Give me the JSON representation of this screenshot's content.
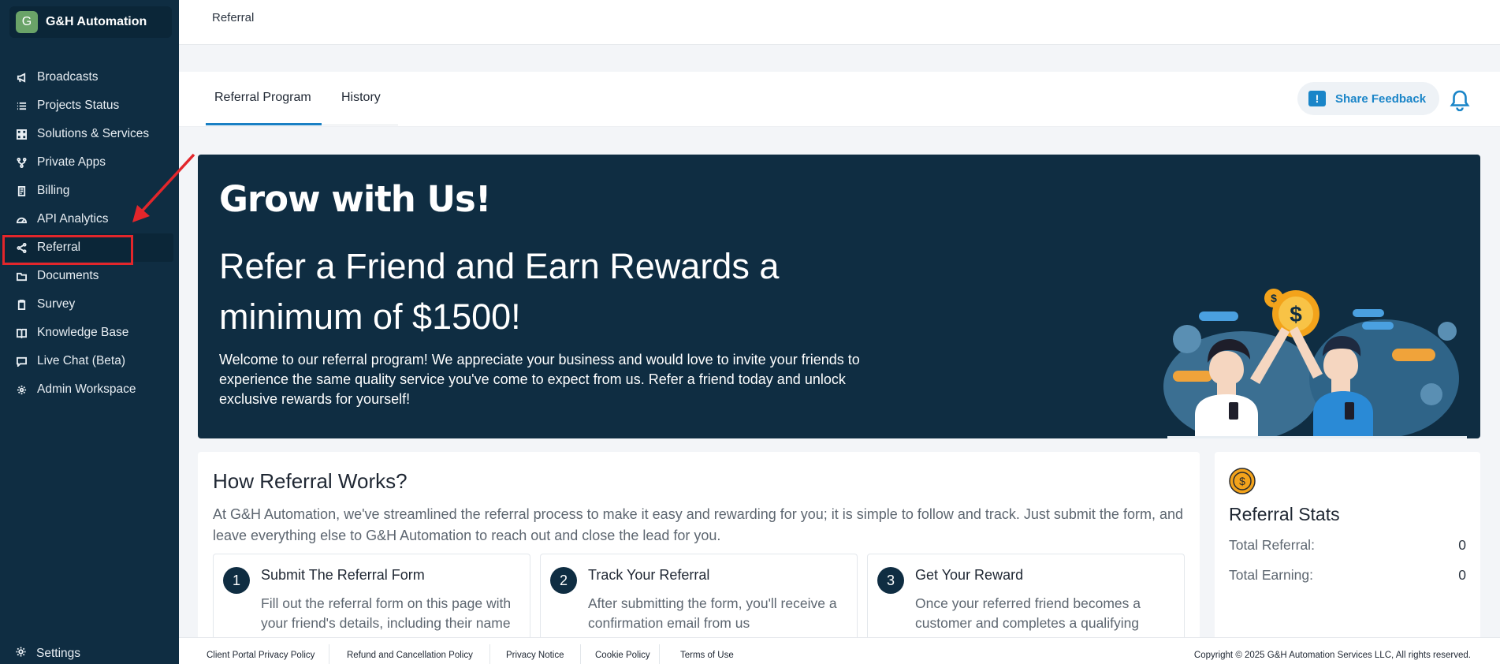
{
  "brand": {
    "initial": "G",
    "name": "G&H Automation"
  },
  "nav": {
    "items": [
      {
        "label": "Broadcasts",
        "icon": "megaphone-icon"
      },
      {
        "label": "Projects Status",
        "icon": "list-icon"
      },
      {
        "label": "Solutions & Services",
        "icon": "grid-icon"
      },
      {
        "label": "Private Apps",
        "icon": "fork-icon"
      },
      {
        "label": "Billing",
        "icon": "receipt-icon"
      },
      {
        "label": "API Analytics",
        "icon": "gauge-icon"
      },
      {
        "label": "Referral",
        "icon": "share-icon"
      },
      {
        "label": "Documents",
        "icon": "folder-icon"
      },
      {
        "label": "Survey",
        "icon": "clipboard-icon"
      },
      {
        "label": "Knowledge Base",
        "icon": "book-icon"
      },
      {
        "label": "Live Chat (Beta)",
        "icon": "chat-icon"
      },
      {
        "label": "Admin Workspace",
        "icon": "admin-icon"
      }
    ],
    "active": "Referral",
    "settings_label": "Settings"
  },
  "header": {
    "breadcrumb": "Referral"
  },
  "tabs": [
    {
      "label": "Referral Program",
      "active": true
    },
    {
      "label": "History",
      "active": false
    }
  ],
  "feedback": {
    "label": "Share Feedback",
    "icon_glyph": "!"
  },
  "hero": {
    "title": "Grow with Us!",
    "subtitle": "Refer a Friend and Earn Rewards a minimum of $1500!",
    "text": "Welcome to our referral program! We appreciate your business and would love to invite your friends to experience the same quality service you've come to expect from us. Refer a friend today and unlock exclusive rewards for yourself!",
    "coin_symbol": "$"
  },
  "how": {
    "title": "How Referral Works?",
    "description": "At G&H Automation, we've streamlined the referral process to make it easy and rewarding for you; it is simple to follow and track. Just submit the form, and leave everything else to G&H Automation to reach out and close the lead for you.",
    "steps": [
      {
        "num": "1",
        "title": "Submit The Referral Form",
        "text": "Fill out the referral form on this page with your friend's details, including their name"
      },
      {
        "num": "2",
        "title": "Track Your Referral",
        "text": "After submitting the form, you'll receive a confirmation email from us"
      },
      {
        "num": "3",
        "title": "Get Your Reward",
        "text": "Once your referred friend becomes a customer and completes a qualifying"
      }
    ]
  },
  "stats": {
    "title": "Referral Stats",
    "total_referral_label": "Total Referral:",
    "total_referral_value": "0",
    "total_earning_label": "Total Earning:",
    "total_earning_value": "0"
  },
  "footer": {
    "links": [
      "Client Portal Privacy Policy",
      "Refund and Cancellation Policy",
      "Privacy Notice",
      "Cookie Policy",
      "Terms of Use"
    ],
    "copyright": "Copyright © 2025 G&H Automation Services LLC, All rights reserved."
  },
  "colors": {
    "sidebar": "#0f2d42",
    "accent": "#1a80c4",
    "highlight": "#e3262b",
    "coin": "#f3a31b"
  }
}
